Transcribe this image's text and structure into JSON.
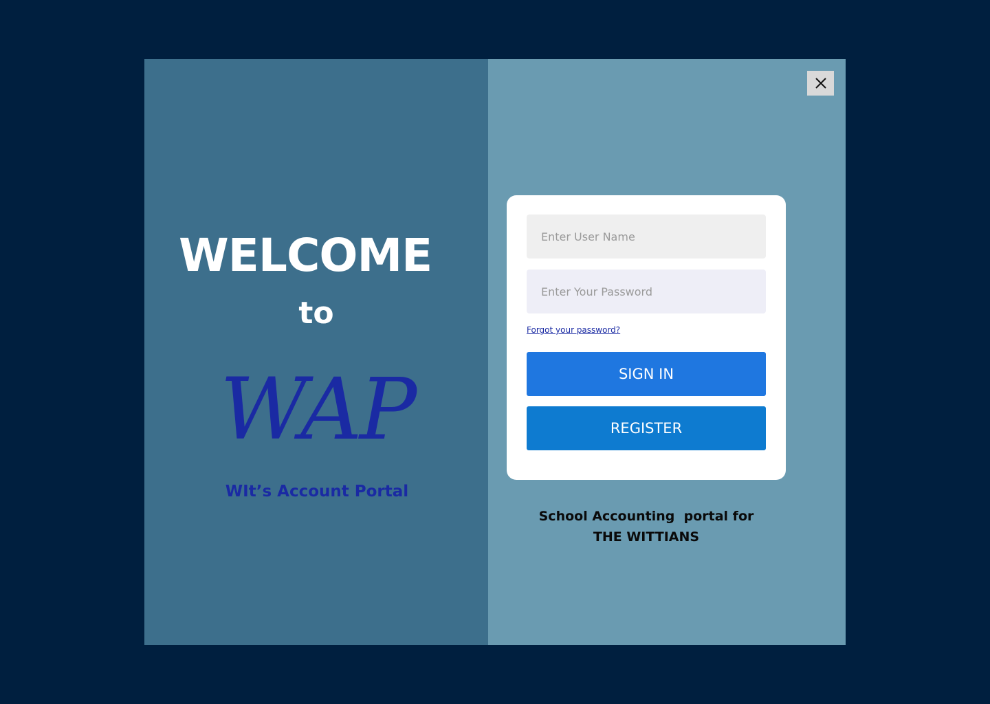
{
  "welcome": {
    "heading": "WELCOME",
    "connector": "to",
    "logo_text": "WAP",
    "subtitle": "WIt’s Account Portal"
  },
  "login": {
    "close_icon": "close-icon",
    "username_placeholder": "Enter User Name",
    "password_placeholder": "Enter Your Password",
    "forgot_label": "Forgot your password?",
    "signin_label": "SIGN IN",
    "register_label": "REGISTER"
  },
  "tagline": {
    "line1": "School Accounting  portal for",
    "line2": "THE WITTIANS"
  },
  "colors": {
    "background": "#001f3f",
    "left_panel": "#3d6f8c",
    "right_panel": "#6a9bb1",
    "brand_blue": "#1a2aa3",
    "signin_button": "#1f77e0",
    "register_button": "#0e7bd0"
  }
}
